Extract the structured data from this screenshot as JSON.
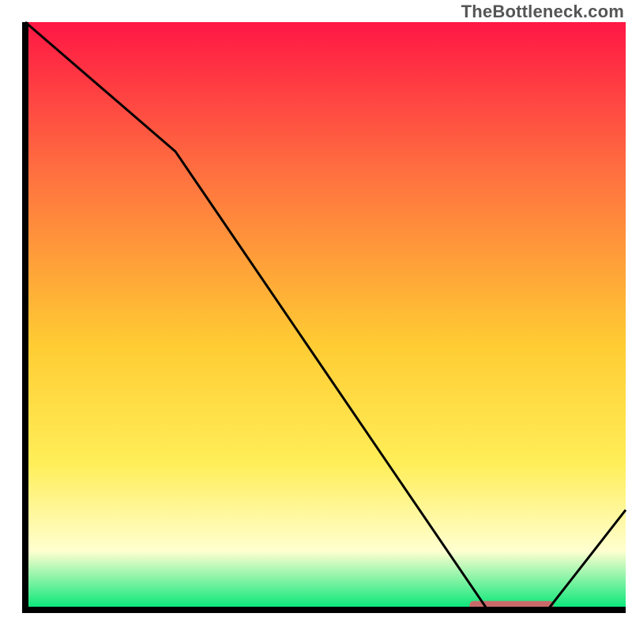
{
  "watermark": "TheBottleneck.com",
  "colors": {
    "frame": "#000000",
    "line": "#000000",
    "notch_fill": "#c96a6a",
    "grad_top": "#ff1744",
    "grad_mid1": "#ff6e40",
    "grad_mid2": "#ffcc33",
    "grad_mid3": "#ffee58",
    "grad_pale": "#ffffd0",
    "grad_green": "#00e676"
  },
  "chart_data": {
    "type": "line",
    "title": "",
    "xlabel": "",
    "ylabel": "",
    "xlim": [
      0,
      100
    ],
    "ylim": [
      0,
      100
    ],
    "x": [
      0,
      25,
      77,
      87,
      100
    ],
    "values": [
      100,
      78,
      0,
      0,
      17
    ],
    "notch": {
      "x_start": 74,
      "x_end": 88,
      "height": 1.5
    },
    "gradient_stops": [
      {
        "pos": 0.0,
        "color": "#ff1744"
      },
      {
        "pos": 0.25,
        "color": "#ff5740"
      },
      {
        "pos": 0.5,
        "color": "#ffb733"
      },
      {
        "pos": 0.7,
        "color": "#ffe24d"
      },
      {
        "pos": 0.85,
        "color": "#ffffc0"
      },
      {
        "pos": 0.97,
        "color": "#b8ff9e"
      },
      {
        "pos": 1.0,
        "color": "#00e676"
      }
    ]
  }
}
